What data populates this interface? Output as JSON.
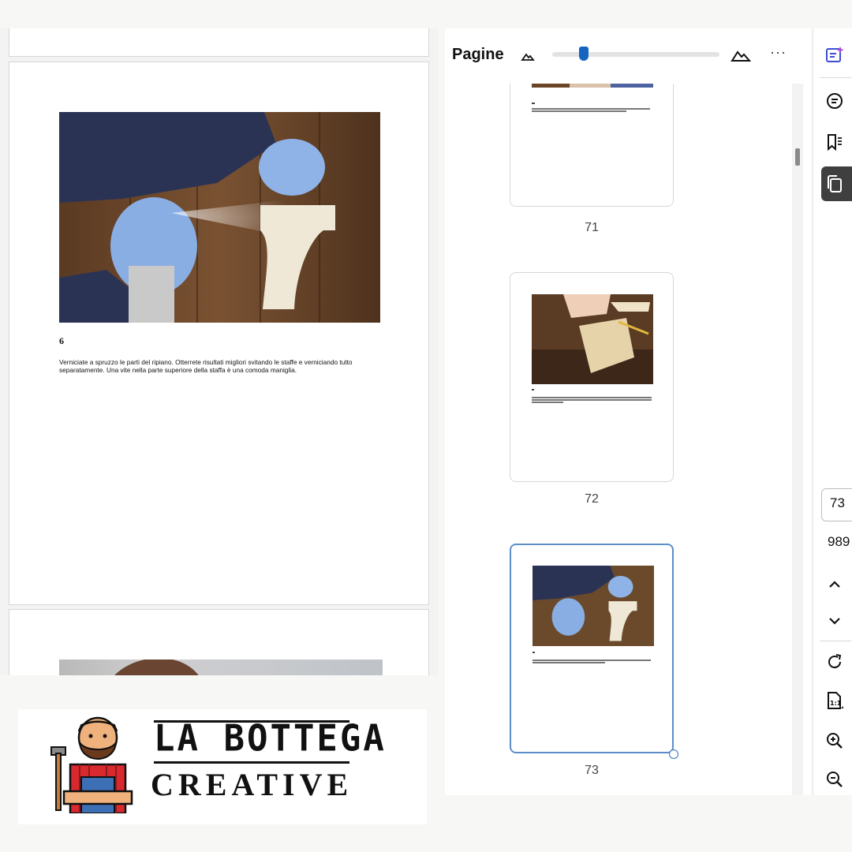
{
  "document": {
    "step_number": "6",
    "step_text": "Verniciate a spruzzo le parti del ripiano. Otterrete risultati migliori svitando le staffe e verniciando tutto separatamente. Una vite nella parte superiore della staffa è una comoda maniglia."
  },
  "thumbnails_panel": {
    "title": "Pagine",
    "zoom_level_fraction": 0.17,
    "more_label": "···",
    "thumbnails": [
      {
        "page_label": "71",
        "selected": false
      },
      {
        "page_label": "72",
        "selected": false
      },
      {
        "page_label": "73",
        "selected": true
      }
    ]
  },
  "toolbar": {
    "current_page": "73",
    "total_pages": "989",
    "icons": [
      "ai-assistant-icon",
      "comment-icon",
      "bookmark-icon",
      "pages-icon",
      "chevron-up-icon",
      "chevron-down-icon",
      "rotate-icon",
      "fit-page-icon",
      "zoom-in-icon",
      "zoom-out-icon"
    ]
  },
  "logo": {
    "line1": "LA BOTTEGA",
    "line2": "CREATIVE"
  },
  "colors": {
    "accent": "#1565c0",
    "selection_border": "#5b8ec7"
  }
}
